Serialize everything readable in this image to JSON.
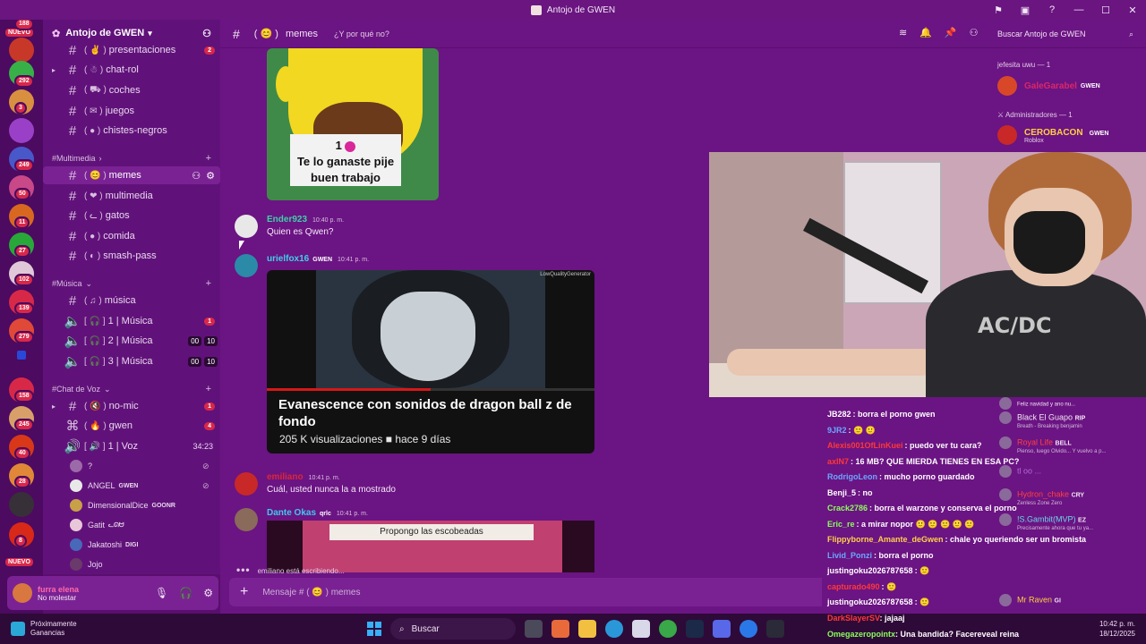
{
  "window": {
    "title": "Antojo de GWEN",
    "controls": [
      "⚑",
      "▣",
      "?",
      "—",
      "☐",
      "✕"
    ]
  },
  "server_list": {
    "badges": [
      {
        "label": "188"
      },
      {
        "label": "292"
      },
      {
        "label": "3"
      },
      {
        "label": "249"
      },
      {
        "label": "50"
      },
      {
        "label": "11"
      },
      {
        "label": "27"
      },
      {
        "label": "102"
      },
      {
        "label": "139"
      },
      {
        "label": "279"
      },
      {
        "label": "158"
      },
      {
        "label": "245"
      },
      {
        "label": "40"
      },
      {
        "label": "28"
      },
      {
        "label": "8"
      }
    ],
    "new_top": "NUEVO",
    "new_bottom": "NUEVO"
  },
  "sidebar": {
    "server_name": "Antojo de GWEN",
    "categories": {
      "multimedia": "#Multimedia",
      "musica": "#Música",
      "chat_voz": "#Chat de Voz"
    },
    "channels": [
      {
        "name": "presentaciones",
        "badge": "2"
      },
      {
        "name": "chat-rol"
      },
      {
        "name": "coches"
      },
      {
        "name": "juegos"
      },
      {
        "name": "chistes-negros"
      },
      {
        "name": "memes"
      },
      {
        "name": "multimedia"
      },
      {
        "name": "gatos"
      },
      {
        "name": "comida"
      },
      {
        "name": "smash-pass"
      },
      {
        "name": "música"
      },
      {
        "name": "1 | Música",
        "badge": "1"
      },
      {
        "name": "2 | Música",
        "count_a": "00",
        "count_b": "10"
      },
      {
        "name": "3 | Música",
        "count_a": "00",
        "count_b": "10"
      },
      {
        "name": "no-mic",
        "badge": "1"
      },
      {
        "name": "gwen",
        "badge": "4"
      },
      {
        "name": "1 | Voz",
        "timer": "34:23"
      }
    ],
    "voice_users": [
      {
        "name": "?"
      },
      {
        "name": "ANGEL",
        "tag": "GWEN"
      },
      {
        "name": "DimensionalDice",
        "tag": "GOONR"
      },
      {
        "name": "Gatit",
        "tag": "ᓚᘏᗢ"
      },
      {
        "name": "Jakatoshi",
        "tag": "DIGI"
      },
      {
        "name": "Jojo"
      }
    ]
  },
  "user_panel": {
    "name": "furra elena",
    "status": "No molestar"
  },
  "header": {
    "channel": "memes",
    "topic": "¿Y por qué no?",
    "search_placeholder": "Buscar Antojo de GWEN"
  },
  "messages": [
    {
      "author": "Ender923",
      "time": "10:40 p. m.",
      "text": "Quien es Qwen?",
      "color": "#3fd0a8"
    },
    {
      "author": "urielfox16",
      "tag": "GWEN",
      "time": "10:41 p. m.",
      "color": "#3fd0e8"
    },
    {
      "author": "emiliano",
      "time": "10:41 p. m.",
      "text": "Cuál, usted nunca la a mostrado",
      "color": "#d82838"
    },
    {
      "author": "Dante Okas",
      "tag": "qrlc",
      "time": "10:41 p. m.",
      "color": "#3fc8f0"
    }
  ],
  "meme1": {
    "count": "1",
    "line1": "Te lo ganaste pije",
    "line2": "buen trabajo"
  },
  "embed": {
    "brand": "LowQualityGenerator",
    "title": "Evanescence con sonidos de dragon ball z de fondo",
    "meta": "205 K visualizaciones ■ hace 9 días",
    "progress": 0.5
  },
  "meme2": {
    "banner": "Propongo las escobeadas"
  },
  "typing": "emiliano está escribiendo...",
  "composer": {
    "placeholder": "Mensaje # ( 😊 ) memes"
  },
  "members": {
    "cat1": "jefesita uwu — 1",
    "m1_name": "GaleGarabel",
    "m1_tag": "GWEN",
    "cat2": "Administradores — 1",
    "m2_name": "CEROBACON",
    "m2_tag": "GWEN",
    "m2_sub": "Roblox"
  },
  "webcam_logo": "AC/DC",
  "twitch_chat": [
    {
      "user": "JB282",
      "msg": ": borra el porno gwen",
      "color": "#ffffff"
    },
    {
      "user": "9JR2",
      "msg": ": 🙂 🙂",
      "color": "#6aa8ff"
    },
    {
      "user": "Alexis001OfLinKuei",
      "msg": ": puedo ver tu cara?",
      "color": "#ff3838"
    },
    {
      "user": "axlN7",
      "msg": ": 16 MB? QUE MIERDA TIENES EN ESA PC?",
      "color": "#ff3838"
    },
    {
      "user": "RodrigoLeon",
      "msg": ": mucho porno guardado",
      "color": "#6aa8ff"
    },
    {
      "user": "Benji_5",
      "msg": ": no",
      "color": "#ffffff"
    },
    {
      "user": "Crack2786",
      "msg": ": borra el warzone y conserva el porno",
      "color": "#8aff5a"
    },
    {
      "user": "Eric_re",
      "msg": ": a mirar nopor 🙂 🙂 🙂 🙂 🙂",
      "color": "#8aff5a"
    },
    {
      "user": "Flippyborne_Amante_deGwen",
      "msg": ": chale yo queriendo ser un bromista",
      "color": "#ffd04a"
    },
    {
      "user": "Livid_Ponzi",
      "msg": ": borra el porno",
      "color": "#6aa8ff"
    },
    {
      "user": "justingoku2026787658",
      "msg": ": 🙂",
      "color": "#ffffff"
    },
    {
      "user": "capturado490",
      "msg": ": 🙂",
      "color": "#ff3838"
    },
    {
      "user": "justingoku2026787658",
      "msg": ": 🙂",
      "color": "#ffffff"
    },
    {
      "user": "DarkSlayerSV",
      "msg": ": jajaaj",
      "color": "#ff3838"
    },
    {
      "user": "Omegazeropointx",
      "msg": ": Una bandida? Facereveal reina",
      "color": "#8aff5a"
    }
  ],
  "twitch_side": [
    {
      "name": "Feliz navidad y ano nu...",
      "sub": ""
    },
    {
      "name": "Black El Guapo",
      "tag": "RIP",
      "sub": "Breath - Breaking benjamin"
    },
    {
      "name": "Royal Life",
      "tag": "BELL",
      "sub": "Pienso, luego Olvido... Y vuelvo a p..."
    },
    {
      "name": "tl oo ...",
      "sub": ""
    },
    {
      "name": "Hydron_chake",
      "tag": "CRY",
      "sub": "Zenless Zone Zero"
    },
    {
      "name": "!S.Gambit(MVP)",
      "tag": "EZ",
      "sub": "Precisamente ahora que tu ya..."
    },
    {
      "name": "Mr Raven",
      "tag": "GI",
      "sub": ""
    }
  ],
  "taskbar": {
    "widget_line1": "Próximamente",
    "widget_line2": "Ganancias",
    "search": "Buscar",
    "time": "10:42 p. m.",
    "date": "18/12/2025"
  }
}
